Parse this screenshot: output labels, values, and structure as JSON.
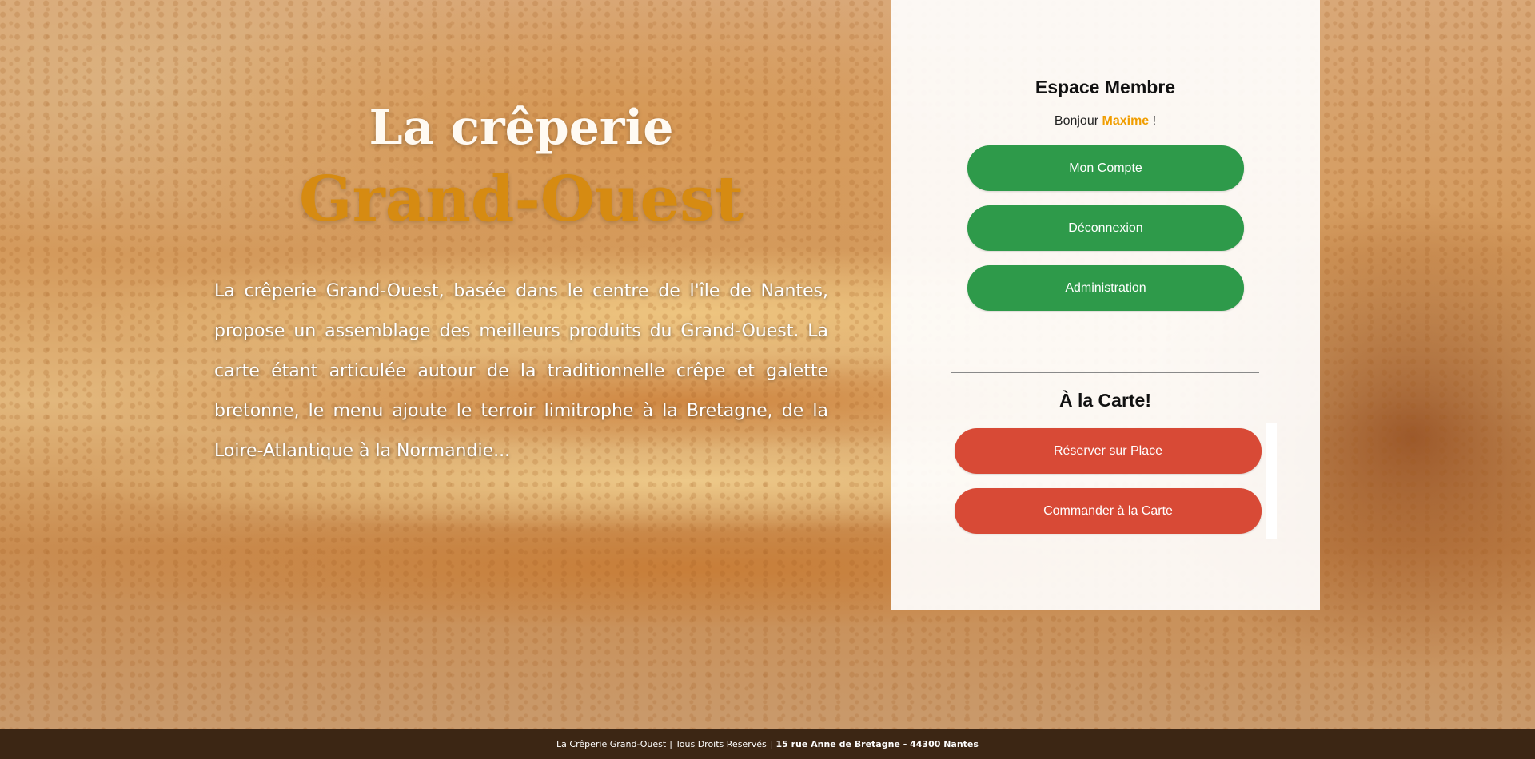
{
  "hero": {
    "title_line1": "La crêperie",
    "title_line2": "Grand-Ouest",
    "description": "La crêperie Grand-Ouest, basée dans le centre de l'île de Nantes, propose un assemblage des meilleurs produits du Grand-Ouest. La carte étant articulée autour de la traditionnelle crêpe et galette bretonne, le menu ajoute le terroir limitrophe à la Bretagne, de la Loire-Atlantique à la Normandie..."
  },
  "member": {
    "title": "Espace Membre",
    "greeting_prefix": "Bonjour",
    "user_name": "Maxime",
    "greeting_suffix": "!",
    "buttons": {
      "account": "Mon Compte",
      "logout": "Déconnexion",
      "admin": "Administration"
    }
  },
  "carte": {
    "title": "À la Carte!",
    "buttons": {
      "reserve": "Réserver sur Place",
      "order": "Commander à la Carte"
    }
  },
  "footer": {
    "brand": "La Crêperie Grand-Ouest",
    "rights": "Tous Droits Reservés",
    "address": "15 rue Anne de Bretagne - 44300 Nantes",
    "separator": "|"
  },
  "colors": {
    "accent_orange": "#d68b12",
    "user_name": "#f09d00",
    "green_button": "#2e9a4a",
    "red_button": "#d84a36",
    "footer_bg": "#3c2614"
  }
}
